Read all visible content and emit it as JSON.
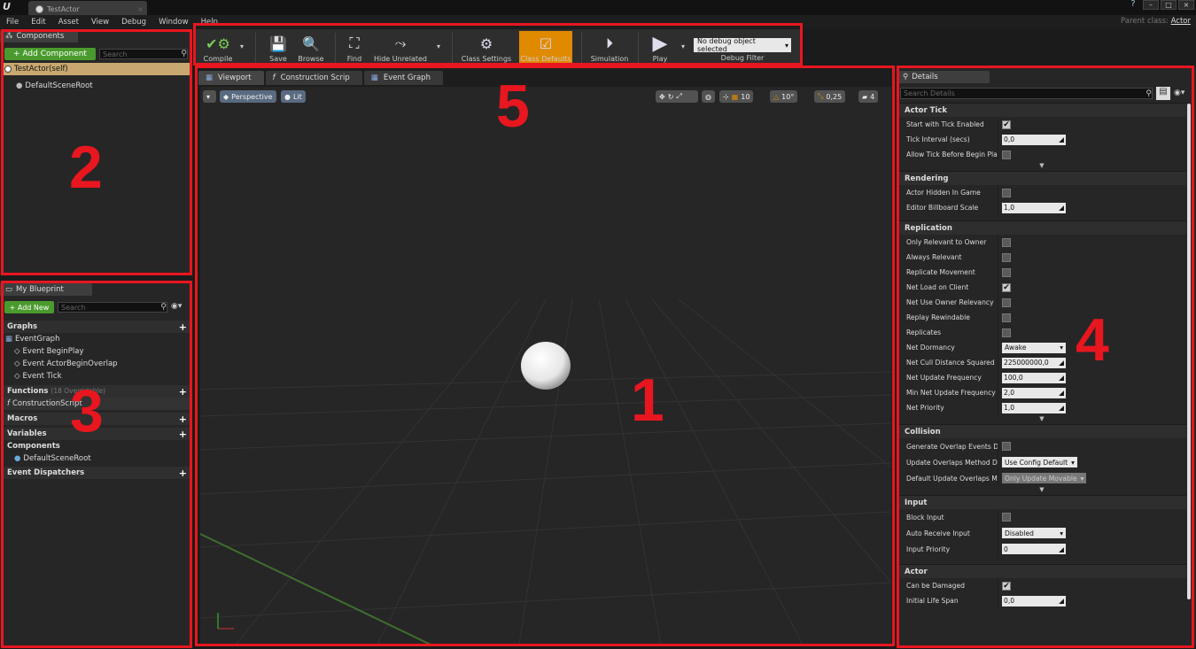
{
  "window": {
    "tab_title": "TestActor",
    "parent_class_label": "Parent class:",
    "parent_class_value": "Actor"
  },
  "menu": [
    "File",
    "Edit",
    "Asset",
    "View",
    "Debug",
    "Window",
    "Help"
  ],
  "components_panel": {
    "tab": "Components",
    "add_button": "+ Add Component",
    "search_placeholder": "Search",
    "root": "TestActor(self)",
    "child": "DefaultSceneRoot"
  },
  "toolbar": {
    "compile": "Compile",
    "save": "Save",
    "browse": "Browse",
    "find": "Find",
    "hide_unrelated": "Hide Unrelated",
    "class_settings": "Class Settings",
    "class_defaults": "Class Defaults",
    "simulation": "Simulation",
    "play": "Play",
    "debug_object": "No debug object selected",
    "debug_filter": "Debug Filter"
  },
  "viewport": {
    "tabs": [
      "Viewport",
      "Construction Scrip",
      "Event Graph"
    ],
    "perspective": "Perspective",
    "lit": "Lit",
    "grid_snap": "10",
    "rot_snap": "10°",
    "scale_snap": "0,25",
    "cam_speed": "4"
  },
  "my_blueprint": {
    "tab": "My Blueprint",
    "add_new": "+ Add New",
    "search_placeholder": "Search",
    "graphs": "Graphs",
    "event_graph": "EventGraph",
    "events": [
      "Event BeginPlay",
      "Event ActorBeginOverlap",
      "Event Tick"
    ],
    "functions": "Functions",
    "functions_note": "(18 Overridable)",
    "construction_script": "ConstructionScript",
    "macros": "Macros",
    "variables": "Variables",
    "components": "Components",
    "default_scene_root": "DefaultSceneRoot",
    "event_dispatchers": "Event Dispatchers"
  },
  "details": {
    "tab": "Details",
    "search_placeholder": "Search Details",
    "sections": {
      "actor_tick": "Actor Tick",
      "rendering": "Rendering",
      "replication": "Replication",
      "collision": "Collision",
      "input": "Input",
      "actor": "Actor"
    },
    "rows": {
      "start_tick": "Start with Tick Enabled",
      "tick_interval": "Tick Interval (secs)",
      "tick_interval_val": "0,0",
      "allow_tick": "Allow Tick Before Begin Play",
      "hidden": "Actor Hidden In Game",
      "billboard": "Editor Billboard Scale",
      "billboard_val": "1,0",
      "only_relevant": "Only Relevant to Owner",
      "always_relevant": "Always Relevant",
      "rep_movement": "Replicate Movement",
      "net_load": "Net Load on Client",
      "owner_relevancy": "Net Use Owner Relevancy",
      "replay": "Replay Rewindable",
      "replicates": "Replicates",
      "dormancy": "Net Dormancy",
      "dormancy_val": "Awake",
      "cull": "Net Cull Distance Squared",
      "cull_val": "225000000,0",
      "update_freq": "Net Update Frequency",
      "update_freq_val": "100,0",
      "min_update": "Min Net Update Frequency",
      "min_update_val": "2,0",
      "priority": "Net Priority",
      "priority_val": "1,0",
      "gen_overlap": "Generate Overlap Events Dur",
      "update_overlaps": "Update Overlaps Method Dur",
      "update_overlaps_val": "Use Config Default",
      "default_overlaps": "Default Update Overlaps Met",
      "default_overlaps_val": "Only Update Movable",
      "block_input": "Block Input",
      "auto_receive": "Auto Receive Input",
      "auto_receive_val": "Disabled",
      "input_priority": "Input Priority",
      "input_priority_val": "0",
      "can_damage": "Can be Damaged",
      "life_span": "Initial Life Span",
      "life_span_val": "0,0"
    }
  },
  "annotations": [
    "1",
    "2",
    "3",
    "4",
    "5"
  ],
  "colors": {
    "highlight": "#e8161f",
    "accent_green": "#4a9a2e",
    "active_orange": "#e08a00"
  }
}
